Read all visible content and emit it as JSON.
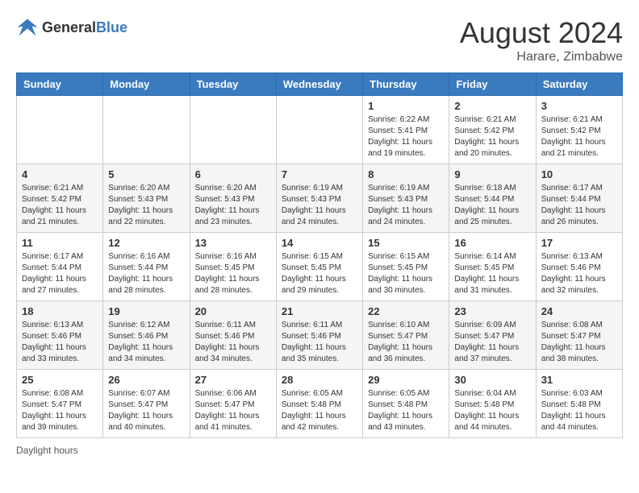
{
  "header": {
    "logo_general": "General",
    "logo_blue": "Blue",
    "month_year": "August 2024",
    "location": "Harare, Zimbabwe"
  },
  "footer": {
    "daylight_label": "Daylight hours"
  },
  "days_of_week": [
    "Sunday",
    "Monday",
    "Tuesday",
    "Wednesday",
    "Thursday",
    "Friday",
    "Saturday"
  ],
  "weeks": [
    [
      {
        "day": "",
        "info": ""
      },
      {
        "day": "",
        "info": ""
      },
      {
        "day": "",
        "info": ""
      },
      {
        "day": "",
        "info": ""
      },
      {
        "day": "1",
        "info": "Sunrise: 6:22 AM\nSunset: 5:41 PM\nDaylight: 11 hours and 19 minutes."
      },
      {
        "day": "2",
        "info": "Sunrise: 6:21 AM\nSunset: 5:42 PM\nDaylight: 11 hours and 20 minutes."
      },
      {
        "day": "3",
        "info": "Sunrise: 6:21 AM\nSunset: 5:42 PM\nDaylight: 11 hours and 21 minutes."
      }
    ],
    [
      {
        "day": "4",
        "info": "Sunrise: 6:21 AM\nSunset: 5:42 PM\nDaylight: 11 hours and 21 minutes."
      },
      {
        "day": "5",
        "info": "Sunrise: 6:20 AM\nSunset: 5:43 PM\nDaylight: 11 hours and 22 minutes."
      },
      {
        "day": "6",
        "info": "Sunrise: 6:20 AM\nSunset: 5:43 PM\nDaylight: 11 hours and 23 minutes."
      },
      {
        "day": "7",
        "info": "Sunrise: 6:19 AM\nSunset: 5:43 PM\nDaylight: 11 hours and 24 minutes."
      },
      {
        "day": "8",
        "info": "Sunrise: 6:19 AM\nSunset: 5:43 PM\nDaylight: 11 hours and 24 minutes."
      },
      {
        "day": "9",
        "info": "Sunrise: 6:18 AM\nSunset: 5:44 PM\nDaylight: 11 hours and 25 minutes."
      },
      {
        "day": "10",
        "info": "Sunrise: 6:17 AM\nSunset: 5:44 PM\nDaylight: 11 hours and 26 minutes."
      }
    ],
    [
      {
        "day": "11",
        "info": "Sunrise: 6:17 AM\nSunset: 5:44 PM\nDaylight: 11 hours and 27 minutes."
      },
      {
        "day": "12",
        "info": "Sunrise: 6:16 AM\nSunset: 5:44 PM\nDaylight: 11 hours and 28 minutes."
      },
      {
        "day": "13",
        "info": "Sunrise: 6:16 AM\nSunset: 5:45 PM\nDaylight: 11 hours and 28 minutes."
      },
      {
        "day": "14",
        "info": "Sunrise: 6:15 AM\nSunset: 5:45 PM\nDaylight: 11 hours and 29 minutes."
      },
      {
        "day": "15",
        "info": "Sunrise: 6:15 AM\nSunset: 5:45 PM\nDaylight: 11 hours and 30 minutes."
      },
      {
        "day": "16",
        "info": "Sunrise: 6:14 AM\nSunset: 5:45 PM\nDaylight: 11 hours and 31 minutes."
      },
      {
        "day": "17",
        "info": "Sunrise: 6:13 AM\nSunset: 5:46 PM\nDaylight: 11 hours and 32 minutes."
      }
    ],
    [
      {
        "day": "18",
        "info": "Sunrise: 6:13 AM\nSunset: 5:46 PM\nDaylight: 11 hours and 33 minutes."
      },
      {
        "day": "19",
        "info": "Sunrise: 6:12 AM\nSunset: 5:46 PM\nDaylight: 11 hours and 34 minutes."
      },
      {
        "day": "20",
        "info": "Sunrise: 6:11 AM\nSunset: 5:46 PM\nDaylight: 11 hours and 34 minutes."
      },
      {
        "day": "21",
        "info": "Sunrise: 6:11 AM\nSunset: 5:46 PM\nDaylight: 11 hours and 35 minutes."
      },
      {
        "day": "22",
        "info": "Sunrise: 6:10 AM\nSunset: 5:47 PM\nDaylight: 11 hours and 36 minutes."
      },
      {
        "day": "23",
        "info": "Sunrise: 6:09 AM\nSunset: 5:47 PM\nDaylight: 11 hours and 37 minutes."
      },
      {
        "day": "24",
        "info": "Sunrise: 6:08 AM\nSunset: 5:47 PM\nDaylight: 11 hours and 38 minutes."
      }
    ],
    [
      {
        "day": "25",
        "info": "Sunrise: 6:08 AM\nSunset: 5:47 PM\nDaylight: 11 hours and 39 minutes."
      },
      {
        "day": "26",
        "info": "Sunrise: 6:07 AM\nSunset: 5:47 PM\nDaylight: 11 hours and 40 minutes."
      },
      {
        "day": "27",
        "info": "Sunrise: 6:06 AM\nSunset: 5:47 PM\nDaylight: 11 hours and 41 minutes."
      },
      {
        "day": "28",
        "info": "Sunrise: 6:05 AM\nSunset: 5:48 PM\nDaylight: 11 hours and 42 minutes."
      },
      {
        "day": "29",
        "info": "Sunrise: 6:05 AM\nSunset: 5:48 PM\nDaylight: 11 hours and 43 minutes."
      },
      {
        "day": "30",
        "info": "Sunrise: 6:04 AM\nSunset: 5:48 PM\nDaylight: 11 hours and 44 minutes."
      },
      {
        "day": "31",
        "info": "Sunrise: 6:03 AM\nSunset: 5:48 PM\nDaylight: 11 hours and 44 minutes."
      }
    ]
  ]
}
